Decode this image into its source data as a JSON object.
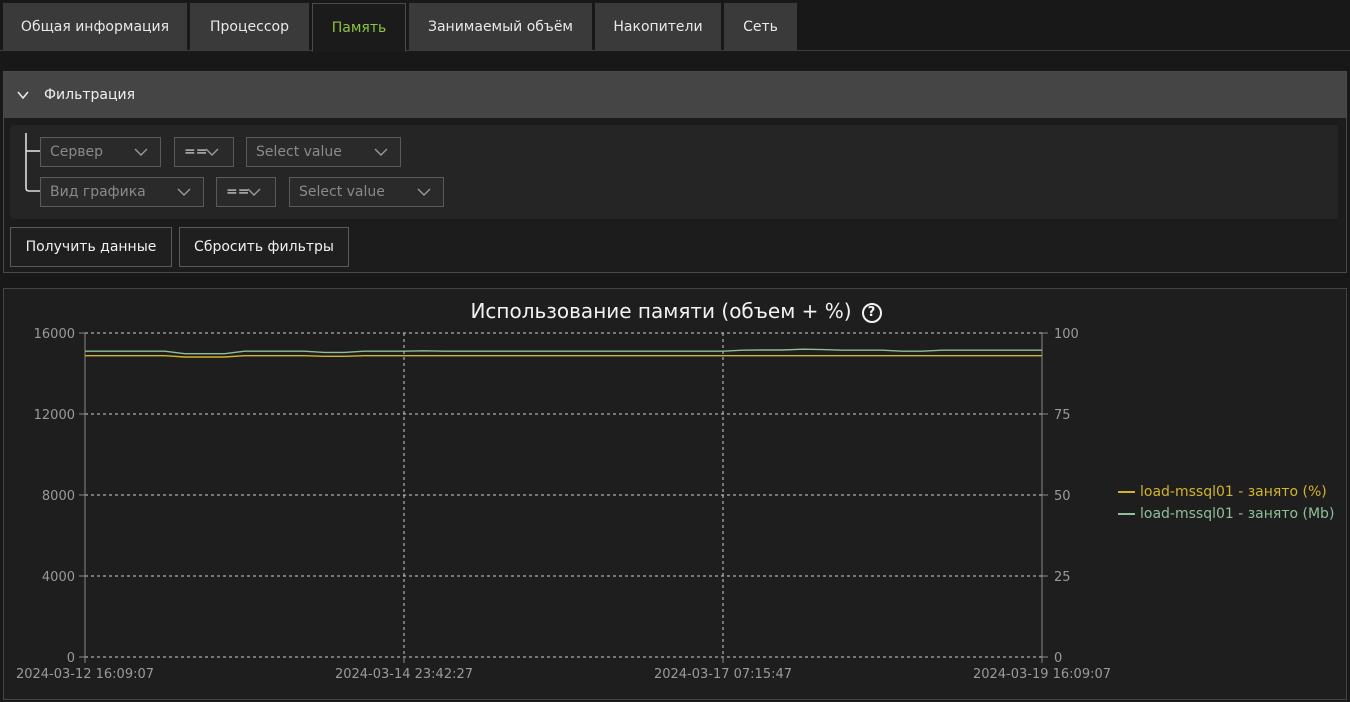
{
  "tabs": [
    {
      "label": "Общая информация",
      "active": false
    },
    {
      "label": "Процессор",
      "active": false
    },
    {
      "label": "Память",
      "active": true
    },
    {
      "label": "Занимаемый объём",
      "active": false
    },
    {
      "label": "Накопители",
      "active": false
    },
    {
      "label": "Сеть",
      "active": false
    }
  ],
  "filter": {
    "title": "Фильтрация",
    "rules": [
      {
        "field": "Сервер",
        "operator": "==",
        "value_placeholder": "Select value"
      },
      {
        "field": "Вид графика",
        "operator": "==",
        "value_placeholder": "Select value"
      }
    ],
    "get_data_label": "Получить данные",
    "reset_label": "Сбросить фильтры"
  },
  "chart_data": {
    "type": "line",
    "title": "Использование памяти (объем + %)",
    "help_icon": "question-circle-icon",
    "x_ticks": [
      "2024-03-12 16:09:07",
      "2024-03-14 23:42:27",
      "2024-03-17 07:15:47",
      "2024-03-19 16:09:07"
    ],
    "x_range": [
      "2024-03-12 16:09:07",
      "2024-03-19 16:09:07"
    ],
    "y_left": {
      "ticks": [
        0,
        4000,
        8000,
        12000,
        16000
      ],
      "range": [
        0,
        16000
      ]
    },
    "y_right": {
      "ticks": [
        0,
        25,
        50,
        75,
        100
      ],
      "range": [
        0,
        100
      ]
    },
    "grid": true,
    "legend_position": "right",
    "series": [
      {
        "name": "load-mssql01 - занято (%)",
        "axis": "right",
        "color": "#d4b32a",
        "values": [
          93,
          93,
          93,
          93,
          93,
          92.6,
          92.6,
          92.6,
          93,
          93,
          93,
          93,
          92.8,
          92.8,
          93,
          93,
          93,
          93,
          93,
          93,
          93,
          93,
          93,
          93,
          93,
          93,
          93,
          93,
          93,
          93,
          93,
          93,
          93,
          93,
          93,
          93,
          93,
          93,
          93,
          93,
          93,
          93,
          93,
          93,
          93,
          93,
          93,
          93,
          93
        ]
      },
      {
        "name": "load-mssql01 - занято (Mb)",
        "axis": "left",
        "color": "#8fbf9a",
        "values": [
          15100,
          15100,
          15100,
          15100,
          15100,
          14980,
          14980,
          14980,
          15100,
          15100,
          15100,
          15100,
          15040,
          15040,
          15100,
          15100,
          15100,
          15120,
          15100,
          15100,
          15100,
          15100,
          15100,
          15100,
          15100,
          15100,
          15100,
          15100,
          15100,
          15100,
          15100,
          15100,
          15100,
          15150,
          15160,
          15160,
          15200,
          15180,
          15150,
          15150,
          15150,
          15100,
          15100,
          15150,
          15150,
          15150,
          15150,
          15150,
          15150
        ]
      }
    ]
  }
}
